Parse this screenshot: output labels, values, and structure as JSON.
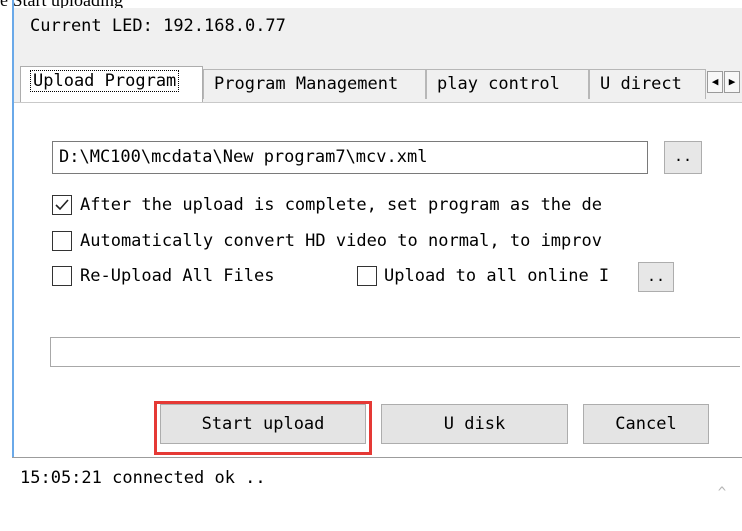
{
  "top_caption": "e Start uploading",
  "header": {
    "current_led_label": "Current LED:",
    "current_led_ip": "192.168.0.77"
  },
  "tabs": [
    {
      "label": "Upload Program",
      "active": true
    },
    {
      "label": "Program Management",
      "active": false
    },
    {
      "label": "play control",
      "active": false
    },
    {
      "label": "U direct",
      "active": false
    }
  ],
  "tab_scroll": {
    "left": "◀",
    "right": "▶"
  },
  "upload": {
    "file_path": "D:\\MC100\\mcdata\\New program7\\mcv.xml",
    "browse_label": "..",
    "options": [
      {
        "label": "After the upload is complete, set program as the de",
        "checked": true
      },
      {
        "label": "Automatically convert HD video to normal, to improv",
        "checked": false
      },
      {
        "label": "Re-Upload All Files",
        "checked": false
      },
      {
        "label": "Upload to all online I",
        "checked": false
      }
    ],
    "online_more_label": "..",
    "progress": 0
  },
  "buttons": {
    "start_upload": "Start upload",
    "u_disk": "U disk",
    "cancel": "Cancel"
  },
  "log": {
    "lines": [
      "15:05:21   connected ok .."
    ],
    "scroll_up": "^"
  },
  "colors": {
    "highlight": "#e53935",
    "accent_bar": "#6aa9e9"
  }
}
